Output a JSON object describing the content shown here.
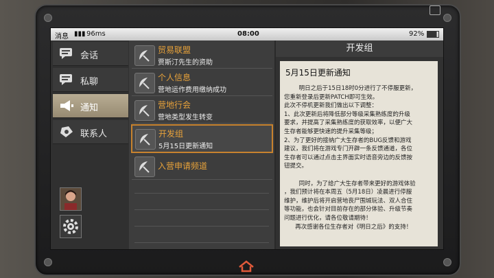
{
  "status": {
    "carrier": "消息",
    "signal": "96ms",
    "time": "08:00",
    "battery": "92%"
  },
  "nav": [
    {
      "label": "会话",
      "icon": "chat-icon"
    },
    {
      "label": "私聊",
      "icon": "private-chat-icon"
    },
    {
      "label": "通知",
      "icon": "megaphone-icon",
      "active": true
    },
    {
      "label": "联系人",
      "icon": "contacts-icon"
    }
  ],
  "channels": [
    {
      "title": "贸易联盟",
      "sub": "贾斯汀先生的资助"
    },
    {
      "title": "个人信息",
      "sub": "营地运作费用缴纳成功"
    },
    {
      "title": "营地行会",
      "sub": "营地类型发生转变"
    },
    {
      "title": "开发组",
      "sub": "5月15日更新通知",
      "selected": true
    },
    {
      "title": "入营申请频道",
      "sub": ""
    }
  ],
  "detail": {
    "header": "开发组",
    "title": "5月15日更新通知",
    "body": "        明日之后于15日18时0分进行了不停服更新，\n您重新登录后更新PATCH即可生效。\n此次不停机更新我们做出以下调整：\n1、此次更新后将降低部分等级采集熟练度的升级\n要求，并提高了采集熟练度的获取效率，以便广大\n生存者能够更快速的提升采集等级；\n2、为了更好的接纳广大生存者的BUG反馈和游戏\n建议，我们将在游戏专门开辟一条反馈通道，各位\n生存者可以通过点击主界面实时语音旁边的反馈按\n钮提交。\n\n        同时，为了给广大生存者带来更好的游戏体验\n，我们预计将在本周五（5月18日）凌晨进行停服\n维护，维护后将开启营地丧尸围城玩法、双人合住\n等功能，也会针对目前存在的部分体验、升级节奏\n问题进行优化，请各位敬请期待！\n      再次感谢各位生存者对《明日之后》的支持！"
  }
}
